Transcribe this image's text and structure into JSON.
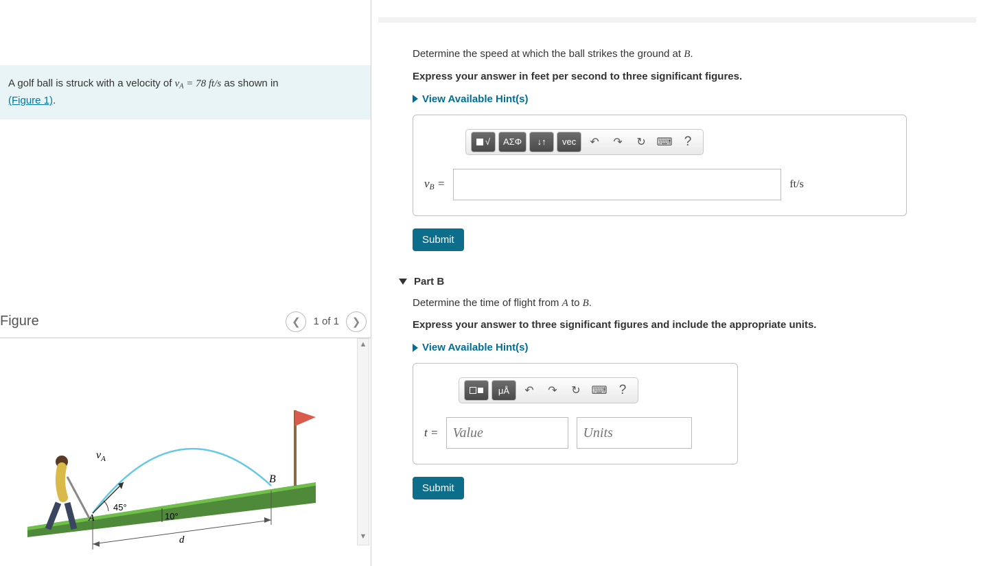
{
  "left": {
    "problem_html_prefix": "A golf ball is struck with a velocity of ",
    "vA_expr": "v_A = 78 ft/s",
    "problem_html_suffix": " as shown in ",
    "figure_link": "(Figure 1)",
    "figure_heading": "Figure",
    "figure_counter": "1 of 1",
    "figure_labels": {
      "vA": "v_A",
      "A": "A",
      "B": "B",
      "ang1": "45°",
      "ang2": "10°",
      "d": "d"
    }
  },
  "partA": {
    "prompt_prefix": "Determine the speed at which the ball strikes the ground at ",
    "prompt_B": "B",
    "prompt_suffix": ".",
    "instruction": "Express your answer in feet per second to three significant figures.",
    "hints_label": "View Available Hint(s)",
    "var": "v_B =",
    "unit": "ft/s",
    "toolbar": {
      "sqrt": "√",
      "greek": "ΑΣΦ",
      "sort": "↓↑",
      "vec": "vec",
      "undo": "↶",
      "redo": "↷",
      "reset": "↻",
      "kb": "⌨",
      "help": "?"
    },
    "submit": "Submit"
  },
  "partB": {
    "header": "Part B",
    "prompt_prefix": "Determine the time of flight from ",
    "prompt_A": "A",
    "prompt_mid": " to ",
    "prompt_B": "B",
    "prompt_suffix": ".",
    "instruction": "Express your answer to three significant figures and include the appropriate units.",
    "hints_label": "View Available Hint(s)",
    "var": "t =",
    "value_ph": "Value",
    "units_ph": "Units",
    "toolbar": {
      "tpl": "□",
      "muA": "μÅ",
      "undo": "↶",
      "redo": "↷",
      "reset": "↻",
      "kb": "⌨",
      "help": "?"
    },
    "submit": "Submit"
  }
}
